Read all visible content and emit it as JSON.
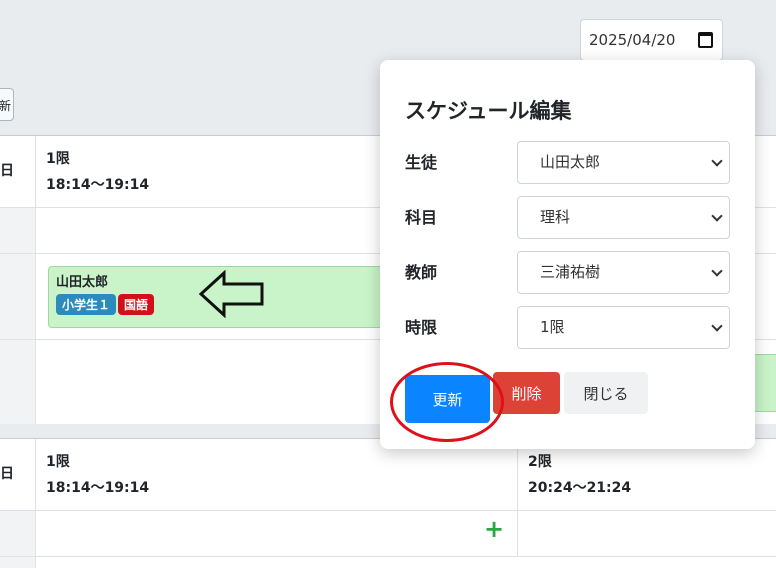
{
  "toolbar": {
    "date_value": "2025/04/20",
    "left_button_label": "新"
  },
  "week1": {
    "day_suffix": "日",
    "period1": {
      "name": "1限",
      "time": "18:14〜19:14"
    },
    "lesson": {
      "student": "山田太郎",
      "grade_badge": "小学生１",
      "subject_badge": "国語"
    }
  },
  "week2": {
    "day_suffix": "日",
    "period1": {
      "name": "1限",
      "time": "18:14〜19:14"
    },
    "period2": {
      "name": "2限",
      "time": "20:24〜21:24"
    },
    "add_symbol": "+"
  },
  "modal": {
    "title": "スケジュール編集",
    "fields": [
      {
        "label": "生徒",
        "value": "山田太郎"
      },
      {
        "label": "科目",
        "value": "理科"
      },
      {
        "label": "教師",
        "value": "三浦祐樹"
      },
      {
        "label": "時限",
        "value": "1限"
      }
    ],
    "update_label": "更新",
    "delete_label": "削除",
    "close_label": "閉じる"
  },
  "colors": {
    "lesson_bg": "#c9f4c9",
    "grade_badge": "#2c8bbd",
    "subject_badge": "#d0101a",
    "primary": "#0a84ff",
    "danger": "#dc4236",
    "annotation": "#e0101a"
  },
  "icons": {
    "calendar": "calendar-icon",
    "chevron": "chevron-down-icon",
    "arrow": "arrow-left-icon",
    "add": "plus-icon"
  }
}
